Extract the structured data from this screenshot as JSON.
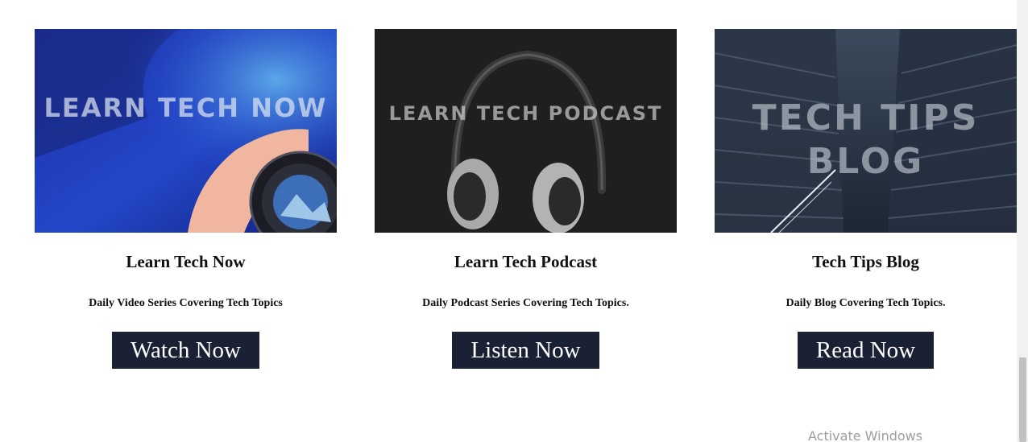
{
  "cards": [
    {
      "image_overlay": "LEARN TECH NOW",
      "title": "Learn Tech Now",
      "description": "Daily Video Series Covering Tech Topics",
      "button": "Watch Now"
    },
    {
      "image_overlay": "LEARN TECH PODCAST",
      "title": "Learn Tech Podcast",
      "description": "Daily Podcast Series Covering Tech Topics.",
      "button": "Listen Now"
    },
    {
      "image_overlay_line1": "TECH TIPS",
      "image_overlay_line2": "BLOG",
      "title": "Tech Tips Blog",
      "description": "Daily Blog Covering Tech Topics.",
      "button": "Read Now"
    }
  ],
  "watermark": "Activate Windows",
  "colors": {
    "button_bg": "#1b2135",
    "button_text": "#ffffff",
    "text": "#111111"
  }
}
